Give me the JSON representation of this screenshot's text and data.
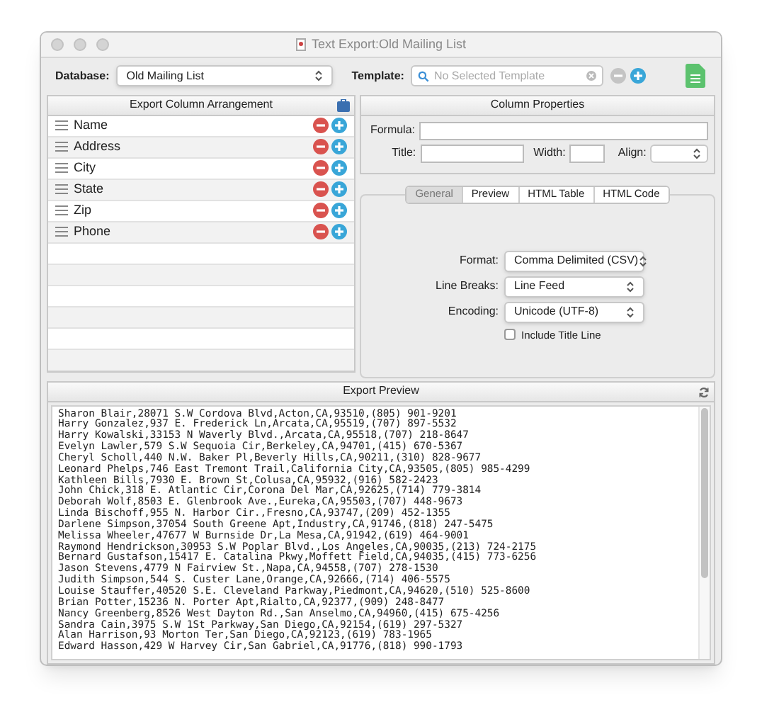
{
  "window": {
    "title": "Text Export:Old Mailing List"
  },
  "toolbar": {
    "database": {
      "label": "Database:",
      "value": "Old Mailing List"
    },
    "template": {
      "label": "Template:",
      "placeholder": "No Selected Template"
    }
  },
  "column_arrangement": {
    "title": "Export Column Arrangement",
    "columns": [
      {
        "name": "Name"
      },
      {
        "name": "Address"
      },
      {
        "name": "City"
      },
      {
        "name": "State"
      },
      {
        "name": "Zip"
      },
      {
        "name": "Phone"
      }
    ]
  },
  "column_properties": {
    "title": "Column Properties",
    "formula": {
      "label": "Formula:"
    },
    "title_field": {
      "label": "Title:"
    },
    "width": {
      "label": "Width:"
    },
    "align": {
      "label": "Align:"
    },
    "tabs": [
      {
        "label": "General",
        "selected": true
      },
      {
        "label": "Preview",
        "selected": false
      },
      {
        "label": "HTML Table",
        "selected": false
      },
      {
        "label": "HTML Code",
        "selected": false
      }
    ],
    "format": {
      "label": "Format:",
      "value": "Comma Delimited (CSV)"
    },
    "line_breaks": {
      "label": "Line Breaks:",
      "value": "Line Feed"
    },
    "encoding": {
      "label": "Encoding:",
      "value": "Unicode (UTF-8)"
    },
    "include_title_line": {
      "label": "Include Title Line",
      "checked": false
    }
  },
  "preview": {
    "title": "Export Preview",
    "lines": [
      "Sharon Blair,28071 S.W Cordova Blvd,Acton,CA,93510,(805) 901-9201",
      "Harry Gonzalez,937 E. Frederick Ln,Arcata,CA,95519,(707) 897-5532",
      "Harry Kowalski,33153 N Waverly Blvd.,Arcata,CA,95518,(707) 218-8647",
      "Evelyn Lawler,579 S.W Sequoia Cir,Berkeley,CA,94701,(415) 670-5367",
      "Cheryl Scholl,440 N.W. Baker Pl,Beverly Hills,CA,90211,(310) 828-9677",
      "Leonard Phelps,746 East Tremont Trail,California City,CA,93505,(805) 985-4299",
      "Kathleen Bills,7930 E. Brown St,Colusa,CA,95932,(916) 582-2423",
      "John Chick,318 E. Atlantic Cir,Corona Del Mar,CA,92625,(714) 779-3814",
      "Deborah Wolf,8503 E. Glenbrook Ave.,Eureka,CA,95503,(707) 448-9673",
      "Linda Bischoff,955 N. Harbor Cir.,Fresno,CA,93747,(209) 452-1355",
      "Darlene Simpson,37054 South Greene Apt,Industry,CA,91746,(818) 247-5475",
      "Melissa Wheeler,47677 W Burnside Dr,La Mesa,CA,91942,(619) 464-9001",
      "Raymond Hendrickson,30953 S.W Poplar Blvd.,Los Angeles,CA,90035,(213) 724-2175",
      "Bernard Gustafson,15417 E. Catalina Pkwy,Moffett Field,CA,94035,(415) 773-6256",
      "Jason Stevens,4779 N Fairview St.,Napa,CA,94558,(707) 278-1530",
      "Judith Simpson,544 S. Custer Lane,Orange,CA,92666,(714) 406-5575",
      "Louise Stauffer,40520 S.E. Cleveland Parkway,Piedmont,CA,94620,(510) 525-8600",
      "Brian Potter,15236 N. Porter Apt,Rialto,CA,92377,(909) 248-8477",
      "Nancy Greenberg,8526 West Dayton Rd.,San Anselmo,CA,94960,(415) 675-4256",
      "Sandra Cain,3975 S.W 1St Parkway,San Diego,CA,92154,(619) 297-5327",
      "Alan Harrison,93 Morton Ter,San Diego,CA,92123,(619) 783-1965",
      "Edward Hasson,429 W Harvey Cir,San Gabriel,CA,91776,(818) 990-1793"
    ]
  }
}
